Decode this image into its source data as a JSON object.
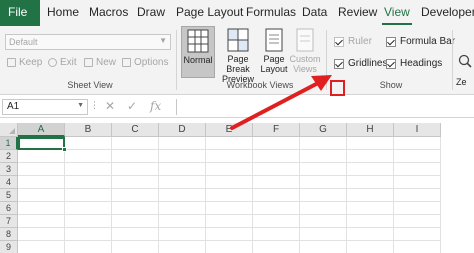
{
  "tabs": [
    {
      "label": "File",
      "key": "file"
    },
    {
      "label": "Home",
      "key": "home"
    },
    {
      "label": "Macros",
      "key": "macros"
    },
    {
      "label": "Draw",
      "key": "draw"
    },
    {
      "label": "Page Layout",
      "key": "page-layout"
    },
    {
      "label": "Formulas",
      "key": "formulas"
    },
    {
      "label": "Data",
      "key": "data"
    },
    {
      "label": "Review",
      "key": "review"
    },
    {
      "label": "View",
      "key": "view"
    },
    {
      "label": "Developer",
      "key": "developer"
    }
  ],
  "active_tab": "View",
  "sheet_view": {
    "select_value": "Default",
    "keep": "Keep",
    "exit": "Exit",
    "new": "New",
    "options": "Options",
    "group_label": "Sheet View"
  },
  "workbook_views": {
    "normal": "Normal",
    "page_break_preview": [
      "Page Break",
      "Preview"
    ],
    "page_layout": [
      "Page",
      "Layout"
    ],
    "custom_views": [
      "Custom",
      "Views"
    ],
    "group_label": "Workbook Views"
  },
  "show": {
    "ruler": {
      "label": "Ruler",
      "checked": true,
      "enabled": false
    },
    "formula_bar": {
      "label": "Formula Bar",
      "checked": true,
      "enabled": true
    },
    "gridlines": {
      "label": "Gridlines",
      "checked": true,
      "enabled": true
    },
    "headings": {
      "label": "Headings",
      "checked": true,
      "enabled": true
    },
    "group_label": "Show"
  },
  "zoom_partial": "Ze",
  "formula_bar": {
    "name_box": "A1",
    "cancel_icon": "✕",
    "enter_icon": "✓",
    "fx": "fx",
    "content": ""
  },
  "grid": {
    "columns": [
      "A",
      "B",
      "C",
      "D",
      "E",
      "F",
      "G",
      "H",
      "I"
    ],
    "rows": [
      "1",
      "2",
      "3",
      "4",
      "5",
      "6",
      "7",
      "8",
      "9"
    ],
    "active_cell": "A1"
  },
  "colors": {
    "accent": "#217346",
    "annotation": "#e02020"
  }
}
